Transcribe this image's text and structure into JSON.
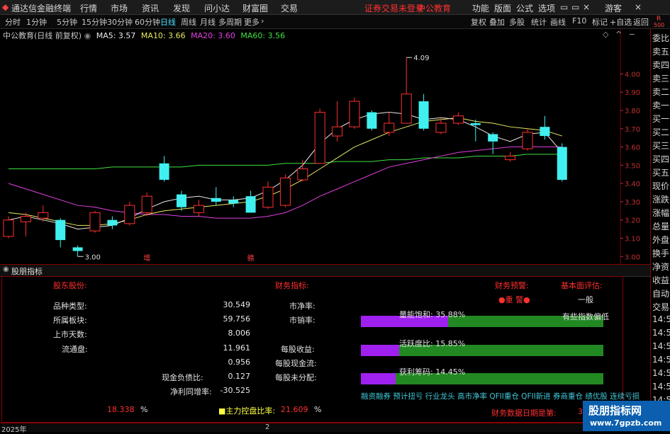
{
  "app": {
    "title": "通达信金融终端",
    "login_status": "证券交易未登录",
    "stock_name_top": "中公教育",
    "guest": "游客"
  },
  "menu": {
    "items": [
      "行情",
      "市场",
      "资讯",
      "发现",
      "问小达",
      "财富圈",
      "交易"
    ],
    "right": [
      "功能",
      "版面",
      "公式",
      "选项"
    ]
  },
  "tabs": {
    "left": [
      "分时",
      "1分钟",
      "5分钟",
      "15分钟",
      "30分钟",
      "60分钟",
      "日线",
      "周线",
      "月线",
      "多周期",
      "更多"
    ],
    "right": [
      "复权",
      "叠加",
      "多股",
      "统计",
      "画线",
      "F10",
      "标记",
      "+自选",
      "返回"
    ],
    "active": "日线"
  },
  "chart": {
    "title": "中公教育(日线 前复权)",
    "ma": [
      {
        "label": "MA5: 3.57",
        "color": "#e8e8e8"
      },
      {
        "label": "MA10: 3.66",
        "color": "#e8e860"
      },
      {
        "label": "MA20: 3.60",
        "color": "#e040e0"
      },
      {
        "label": "MA60: 3.56",
        "color": "#40e040"
      }
    ],
    "high_label": "4.09",
    "low_label": "3.00",
    "markers": [
      "增",
      "赣"
    ],
    "colors": {
      "up": "#ff3030",
      "down": "#40f0f0",
      "grid": "#800000"
    }
  },
  "chart_data": {
    "type": "candlestick",
    "ylim": [
      2.97,
      4.18
    ],
    "y_ticks": [
      "4.00",
      "3.90",
      "3.80",
      "3.70",
      "3.60",
      "3.50",
      "3.40",
      "3.30",
      "3.20",
      "3.10",
      "3.00"
    ],
    "candles": [
      {
        "o": 3.11,
        "c": 3.2,
        "h": 3.22,
        "l": 3.1
      },
      {
        "o": 3.19,
        "c": 3.22,
        "h": 3.24,
        "l": 3.11
      },
      {
        "o": 3.21,
        "c": 3.24,
        "h": 3.28,
        "l": 3.19
      },
      {
        "o": 3.2,
        "c": 3.09,
        "h": 3.21,
        "l": 3.05
      },
      {
        "o": 3.05,
        "c": 3.03,
        "h": 3.06,
        "l": 3.0
      },
      {
        "o": 3.14,
        "c": 3.24,
        "h": 3.25,
        "l": 3.13
      },
      {
        "o": 3.2,
        "c": 3.17,
        "h": 3.22,
        "l": 3.15
      },
      {
        "o": 3.18,
        "c": 3.28,
        "h": 3.3,
        "l": 3.17
      },
      {
        "o": 3.24,
        "c": 3.33,
        "h": 3.35,
        "l": 3.22
      },
      {
        "o": 3.51,
        "c": 3.42,
        "h": 3.55,
        "l": 3.41
      },
      {
        "o": 3.34,
        "c": 3.27,
        "h": 3.36,
        "l": 3.25
      },
      {
        "o": 3.24,
        "c": 3.28,
        "h": 3.31,
        "l": 3.22
      },
      {
        "o": 3.32,
        "c": 3.3,
        "h": 3.38,
        "l": 3.28
      },
      {
        "o": 3.31,
        "c": 3.29,
        "h": 3.33,
        "l": 3.27
      },
      {
        "o": 3.33,
        "c": 3.24,
        "h": 3.36,
        "l": 3.24
      },
      {
        "o": 3.27,
        "c": 3.38,
        "h": 3.41,
        "l": 3.26
      },
      {
        "o": 3.28,
        "c": 3.43,
        "h": 3.45,
        "l": 3.27
      },
      {
        "o": 3.42,
        "c": 3.48,
        "h": 3.53,
        "l": 3.41
      },
      {
        "o": 3.51,
        "c": 3.79,
        "h": 3.81,
        "l": 3.51
      },
      {
        "o": 3.66,
        "c": 3.71,
        "h": 3.85,
        "l": 3.63
      },
      {
        "o": 3.71,
        "c": 3.85,
        "h": 3.87,
        "l": 3.7
      },
      {
        "o": 3.79,
        "c": 3.7,
        "h": 3.8,
        "l": 3.69
      },
      {
        "o": 3.68,
        "c": 3.73,
        "h": 3.79,
        "l": 3.66
      },
      {
        "o": 3.73,
        "c": 3.89,
        "h": 4.09,
        "l": 3.73
      },
      {
        "o": 3.85,
        "c": 3.7,
        "h": 3.89,
        "l": 3.69
      },
      {
        "o": 3.68,
        "c": 3.73,
        "h": 3.76,
        "l": 3.67
      },
      {
        "o": 3.73,
        "c": 3.77,
        "h": 3.79,
        "l": 3.72
      },
      {
        "o": 3.73,
        "c": 3.72,
        "h": 3.75,
        "l": 3.63
      },
      {
        "o": 3.67,
        "c": 3.63,
        "h": 3.68,
        "l": 3.56
      },
      {
        "o": 3.53,
        "c": 3.55,
        "h": 3.57,
        "l": 3.52
      },
      {
        "o": 3.59,
        "c": 3.68,
        "h": 3.7,
        "l": 3.58
      },
      {
        "o": 3.71,
        "c": 3.66,
        "h": 3.77,
        "l": 3.64
      },
      {
        "o": 3.6,
        "c": 3.42,
        "h": 3.62,
        "l": 3.41
      }
    ],
    "ma5": [
      3.2,
      3.22,
      3.2,
      3.18,
      3.15,
      3.16,
      3.17,
      3.21,
      3.26,
      3.3,
      3.32,
      3.33,
      3.31,
      3.31,
      3.32,
      3.36,
      3.42,
      3.5,
      3.62,
      3.7,
      3.75,
      3.78,
      3.79,
      3.78,
      3.75,
      3.76,
      3.75,
      3.71,
      3.66,
      3.63,
      3.67,
      3.68,
      3.57
    ],
    "ma10": [
      3.24,
      3.23,
      3.21,
      3.19,
      3.17,
      3.17,
      3.18,
      3.2,
      3.23,
      3.25,
      3.26,
      3.27,
      3.28,
      3.29,
      3.3,
      3.33,
      3.37,
      3.42,
      3.48,
      3.54,
      3.6,
      3.64,
      3.68,
      3.71,
      3.74,
      3.75,
      3.76,
      3.74,
      3.73,
      3.71,
      3.7,
      3.69,
      3.66
    ],
    "ma20": [
      3.4,
      3.37,
      3.34,
      3.31,
      3.28,
      3.27,
      3.25,
      3.24,
      3.23,
      3.23,
      3.22,
      3.22,
      3.21,
      3.21,
      3.21,
      3.22,
      3.24,
      3.28,
      3.33,
      3.37,
      3.41,
      3.45,
      3.49,
      3.51,
      3.53,
      3.55,
      3.57,
      3.58,
      3.59,
      3.6,
      3.6,
      3.6,
      3.6
    ],
    "ma60": [
      3.48,
      3.48,
      3.48,
      3.48,
      3.48,
      3.48,
      3.49,
      3.49,
      3.49,
      3.49,
      3.49,
      3.5,
      3.5,
      3.5,
      3.5,
      3.5,
      3.51,
      3.51,
      3.51,
      3.52,
      3.52,
      3.52,
      3.53,
      3.53,
      3.54,
      3.54,
      3.54,
      3.55,
      3.55,
      3.55,
      3.56,
      3.56,
      3.56
    ]
  },
  "indicator": {
    "panel_title": "股朋指标",
    "shareholder_header": "股东股份:",
    "finance_header": "财务指标:",
    "warn_header": "财务预警:",
    "eval_header": "基本面评估:",
    "warn_value": "●重 警●",
    "eval_value": "一般",
    "eval_note": "有些指数偏低",
    "rows_left": [
      {
        "label": "品种类型:",
        "value": "30.549"
      },
      {
        "label": "所属板块:",
        "value": "59.756"
      },
      {
        "label": "上市天数:",
        "value": "8.006"
      },
      {
        "label": "流通盘:",
        "value": "11.961"
      },
      {
        "label": "",
        "value": "0.956"
      },
      {
        "label": "现金负债比:",
        "value": "0.127"
      },
      {
        "label": "净利同增率:",
        "value": "-30.525"
      }
    ],
    "rows_mid": [
      "市净率:",
      "市销率:",
      "每股收益:",
      "每股现金流:",
      "每股未分配:"
    ],
    "bars": [
      {
        "label": "量能饱和: 35.88%",
        "fill": 0.3588
      },
      {
        "label": "活跃度比: 15.85%",
        "fill": 0.1585
      },
      {
        "label": "获利筹码: 14.45%",
        "fill": 0.1445
      }
    ],
    "tags": "融资融券 预计扭亏 行业龙头 高市净率 QFII重仓 QFII新进 券商重仓 绩优股 连续亏损",
    "bottom_left_value": "18.338",
    "pct1": "%",
    "main_control_label": "■主力控盘比率:",
    "main_control_value": "21.609",
    "pct2": "%",
    "fin_date_label": "财务数据日期是第:",
    "fin_date_value": "3"
  },
  "right_panel": {
    "top": [
      "R",
      "500"
    ],
    "items": [
      "委比",
      "卖五",
      "卖四",
      "卖三",
      "卖二",
      "卖一",
      "买一",
      "买二",
      "买三",
      "买四",
      "买五",
      "现价",
      "涨跌",
      "涨幅",
      "总量",
      "外盘",
      "换手",
      "净资",
      "收益",
      "自动",
      "交易"
    ],
    "times": [
      "14:5",
      "14:5",
      "14:5",
      "14:5",
      "14:5",
      "14:5",
      "14:5",
      "14:5",
      "14:5",
      "14:5"
    ]
  },
  "bottom": {
    "year": "2025年",
    "page": "2"
  },
  "watermark": {
    "line1": "股朋指标网",
    "line2": "www.7gpzb.com"
  }
}
